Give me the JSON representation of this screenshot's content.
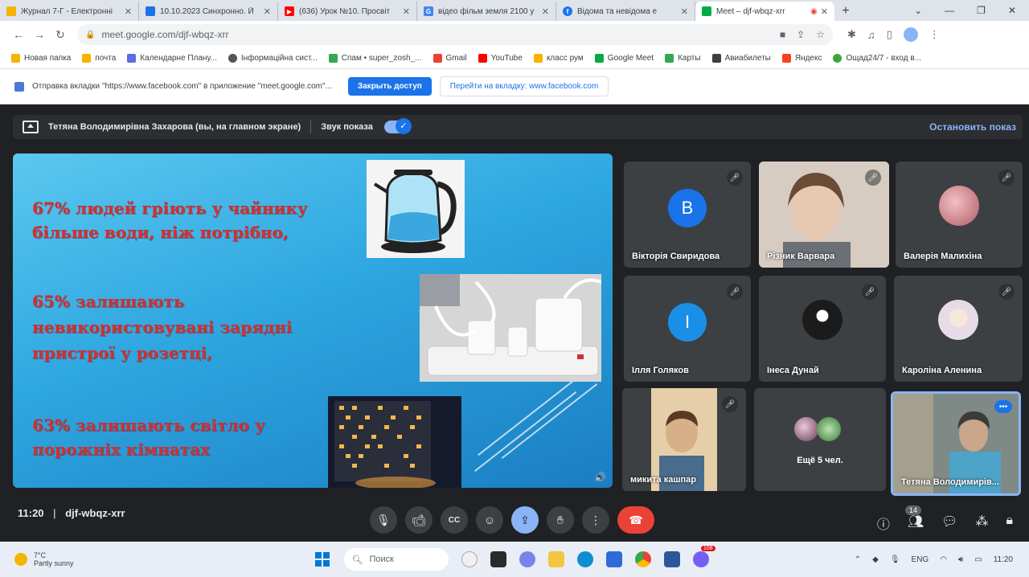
{
  "browser": {
    "tabs": [
      {
        "title": "Журнал 7-Г - Електронні",
        "fav_color": "#f5b400",
        "fav_icon": "journal-icon"
      },
      {
        "title": "10.10.2023 Синхронно. Й",
        "fav_color": "#1a73e8",
        "fav_icon": "classroom-icon"
      },
      {
        "title": "(636) Урок №10. Просвіт",
        "fav_color": "#ff0000",
        "fav_icon": "youtube-icon"
      },
      {
        "title": "відео фільм земля 2100 у",
        "fav_color": "#4285f4",
        "fav_icon": "google-icon"
      },
      {
        "title": "Відома та невідома е",
        "fav_color": "#1877f2",
        "fav_icon": "facebook-icon"
      },
      {
        "title": "Meet – djf-wbqz-xrr",
        "fav_color": "#00ac47",
        "fav_icon": "meet-icon"
      }
    ],
    "new_tab": "+",
    "url": "meet.google.com/djf-wbqz-xrr",
    "bookmarks": [
      {
        "label": "Новая папка",
        "color": "#f5b400",
        "icon": "folder-icon"
      },
      {
        "label": "почта",
        "color": "#f5b400",
        "icon": "folder-icon"
      },
      {
        "label": "Календарне Плану...",
        "color": "#5b6ee1",
        "icon": "calendar-icon"
      },
      {
        "label": "Інформаційна сист...",
        "color": "#555555",
        "icon": "info-icon"
      },
      {
        "label": "Спам • super_zosh_...",
        "color": "#34a853",
        "icon": "spam-icon"
      },
      {
        "label": "Gmail",
        "color": "#ea4335",
        "icon": "gmail-icon"
      },
      {
        "label": "YouTube",
        "color": "#ff0000",
        "icon": "youtube-icon"
      },
      {
        "label": "класс рум",
        "color": "#f5b400",
        "icon": "classroom-icon"
      },
      {
        "label": "Google Meet",
        "color": "#00ac47",
        "icon": "meet-icon"
      },
      {
        "label": "Карты",
        "color": "#34a853",
        "icon": "maps-icon"
      },
      {
        "label": "Авиабилеты",
        "color": "#3c4043",
        "icon": "plane-icon"
      },
      {
        "label": "Яндекс",
        "color": "#fc3f1d",
        "icon": "yandex-icon"
      },
      {
        "label": "Ощад24/7 - вход в...",
        "color": "#3ca63c",
        "icon": "oschad-icon"
      }
    ],
    "infobar": {
      "text": "Отправка вкладки \"https://www.facebook.com\" в приложение \"meet.google.com\"...",
      "primary_button": "Закрыть доступ",
      "secondary_button": "Перейти на вкладку: www.facebook.com"
    }
  },
  "meet": {
    "presenter_text": "Тетяна Володимирівна Захарова (вы, на главном экране)",
    "sound_label": "Звук показа",
    "stop_label": "Остановить показ",
    "slide": {
      "lines": [
        "67% людей гріють у чайнику",
        "більше води, ніж потрібно,",
        "65% залишають",
        "невикористовувані зарядні",
        "пристрої у розетці,",
        "63% залишають світло у",
        "порожніх кімнатах"
      ]
    },
    "participants": [
      {
        "name": "Вікторія Свиридова",
        "initial": "В",
        "avatar_color": "#1a73e8",
        "type": "initial"
      },
      {
        "name": "Різник Варвара",
        "type": "video",
        "bg": "#c9b8a8"
      },
      {
        "name": "Валерія Малихіна",
        "type": "photo",
        "bg": "#d0848a"
      },
      {
        "name": "Ілля Голяков",
        "initial": "І",
        "avatar_color": "#1a8fe8",
        "type": "initial"
      },
      {
        "name": "Інеса Дунай",
        "type": "photo",
        "bg": "#2a2a2a"
      },
      {
        "name": "Кароліна Аленина",
        "type": "photo",
        "bg": "#e9e4ea"
      },
      {
        "name": "микита кашпар",
        "type": "video",
        "bg": "#d8b98a"
      },
      {
        "name": "Ещё 5 чел.",
        "type": "more"
      },
      {
        "name": "Тетяна Володимирів...",
        "type": "video",
        "bg": "#6d7a78"
      }
    ],
    "time": "11:20",
    "separator": "|",
    "meeting_code": "djf-wbqz-xrr",
    "participant_count": "14",
    "more_badge": "•••"
  },
  "taskbar": {
    "weather_temp": "7°C",
    "weather_text": "Partly sunny",
    "search_placeholder": "Поиск",
    "lang": "ENG",
    "clock": "11:20",
    "notification_badge": "108"
  }
}
